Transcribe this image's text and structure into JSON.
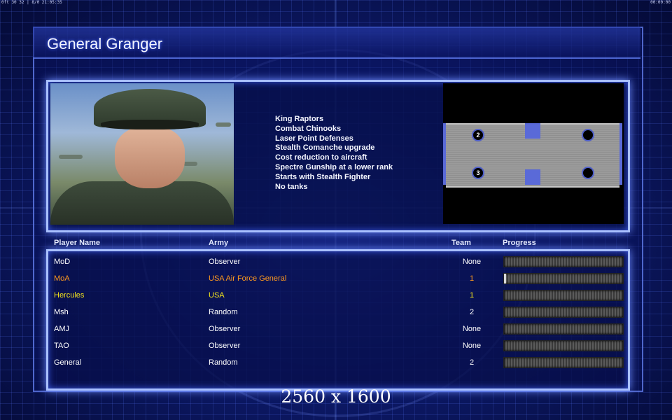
{
  "top_left_status": "0ft 30 32 | 8/0 21:05:35",
  "top_right_status": "00:00:00",
  "general": {
    "name": "General Granger",
    "features": [
      "King Raptors",
      "Combat Chinooks",
      "Laser Point Defenses",
      "Stealth Comanche upgrade",
      "Cost reduction to aircraft",
      "Spectre Gunship at a lower rank",
      "Starts with Stealth Fighter",
      "No tanks"
    ]
  },
  "minimap": {
    "spots": [
      "2",
      "",
      "3",
      ""
    ]
  },
  "table": {
    "headers": {
      "player_name": "Player Name",
      "army": "Army",
      "team": "Team",
      "progress": "Progress"
    },
    "rows": [
      {
        "name": "MoD",
        "army": "Observer",
        "team": "None",
        "color": "#ffffff",
        "progress": 0
      },
      {
        "name": "MoA",
        "army": "USA Air Force General",
        "team": "1",
        "color": "#ff9a1e",
        "progress": 0.02
      },
      {
        "name": "Hercules",
        "army": "USA",
        "team": "1",
        "color": "#f2e21c",
        "progress": 0
      },
      {
        "name": "Msh",
        "army": "Random",
        "team": "2",
        "color": "#ffffff",
        "progress": 0
      },
      {
        "name": "AMJ",
        "army": "Observer",
        "team": "None",
        "color": "#ffffff",
        "progress": 0
      },
      {
        "name": "TAO",
        "army": "Observer",
        "team": "None",
        "color": "#ffffff",
        "progress": 0
      },
      {
        "name": "General",
        "army": "Random",
        "team": "2",
        "color": "#ffffff",
        "progress": 0
      }
    ]
  },
  "resolution_label": "2560 x 1600"
}
